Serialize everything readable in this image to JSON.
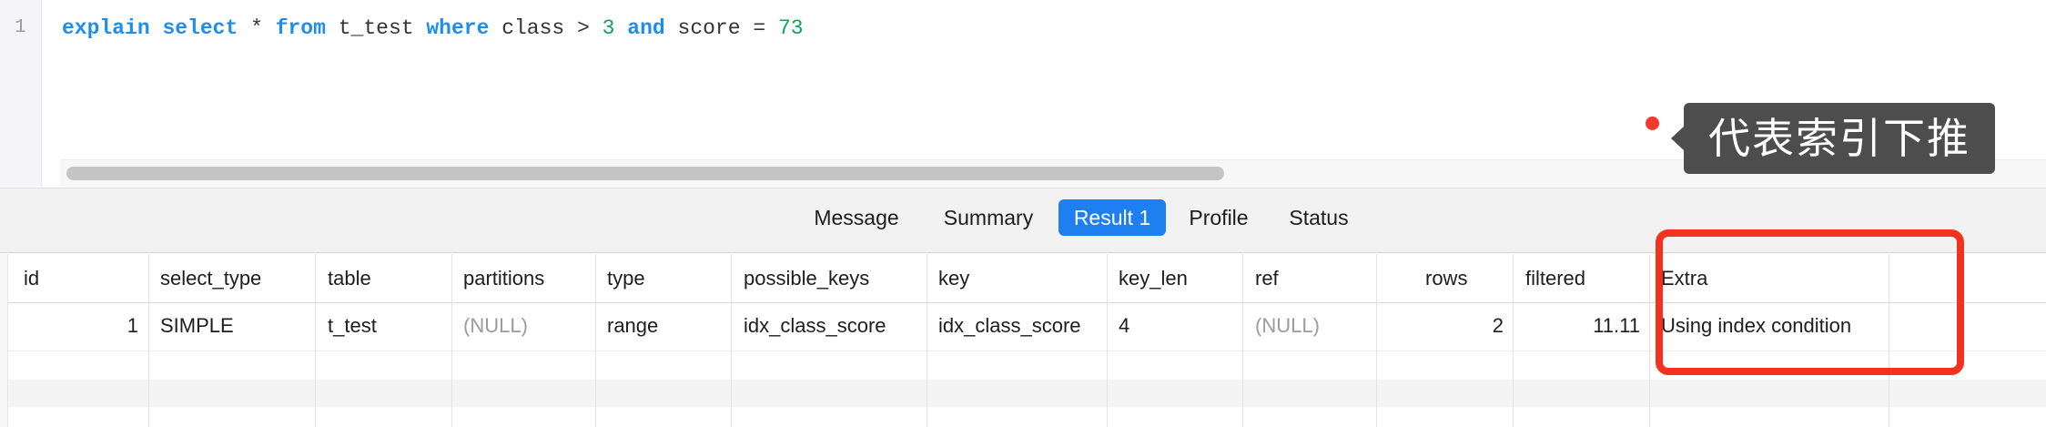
{
  "editor": {
    "line_number": "1",
    "query": {
      "kw_explain": "explain",
      "kw_select": "select",
      "star": "*",
      "kw_from": "from",
      "table": "t_test",
      "kw_where": "where",
      "col_class": "class",
      "op_gt": ">",
      "val_3": "3",
      "kw_and": "and",
      "col_score": "score",
      "op_eq": "=",
      "val_73": "73"
    }
  },
  "annotation": {
    "text": "代表索引下推",
    "dot_color": "#f03a2b",
    "box_color": "#f3311f"
  },
  "tabs": [
    {
      "label": "Message",
      "active": false
    },
    {
      "label": "Summary",
      "active": false
    },
    {
      "label": "Result 1",
      "active": true
    },
    {
      "label": "Profile",
      "active": false
    },
    {
      "label": "Status",
      "active": false
    }
  ],
  "results": {
    "columns": [
      "id",
      "select_type",
      "table",
      "partitions",
      "type",
      "possible_keys",
      "key",
      "key_len",
      "ref",
      "rows",
      "filtered",
      "Extra"
    ],
    "rows": [
      [
        "1",
        "SIMPLE",
        "t_test",
        "(NULL)",
        "range",
        "idx_class_score",
        "idx_class_score",
        "4",
        "(NULL)",
        "2",
        "11.11",
        "Using index condition"
      ]
    ]
  },
  "colors": {
    "accent": "#1e7ff0",
    "keyword": "#1f8eea",
    "number": "#1e9c5a"
  }
}
